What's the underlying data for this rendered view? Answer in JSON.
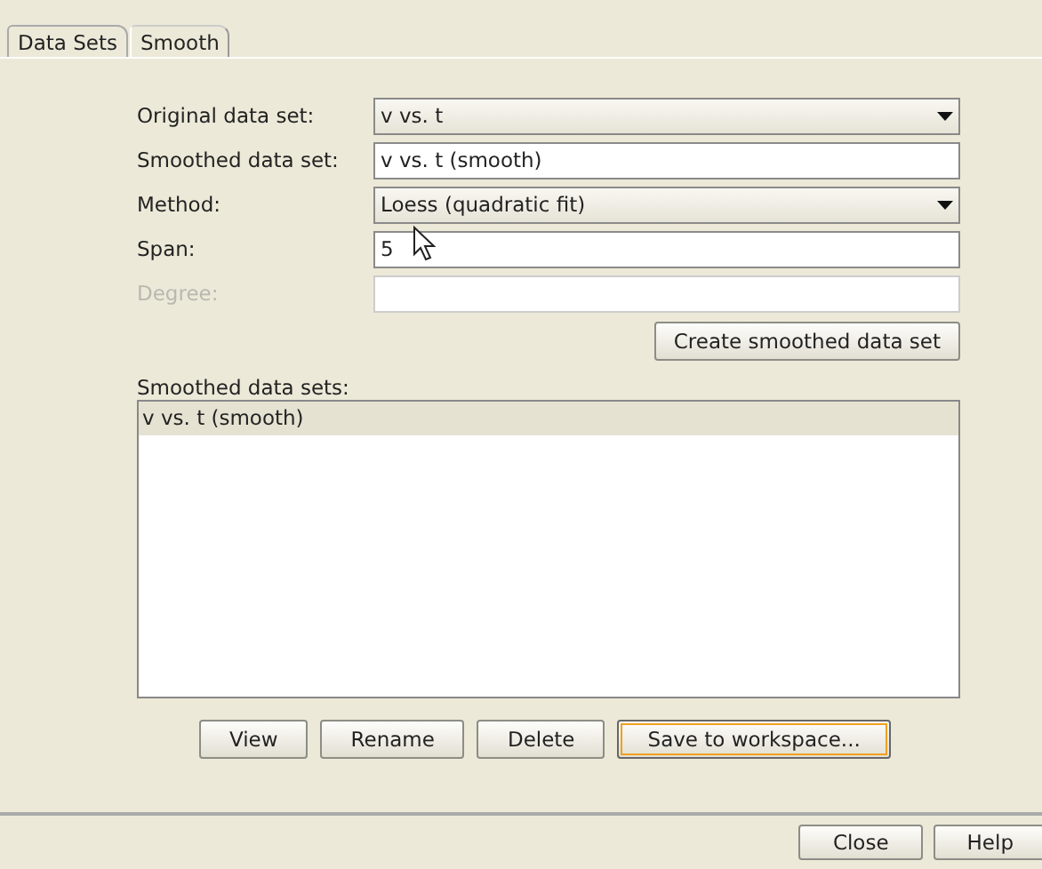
{
  "tabs": [
    {
      "label": "Data Sets",
      "selected": false
    },
    {
      "label": "Smooth",
      "selected": true
    }
  ],
  "form": [
    {
      "label": "Original data set:",
      "kind": "dropdown",
      "value": "v vs. t",
      "disabled": false
    },
    {
      "label": "Smoothed data set:",
      "kind": "text",
      "value": "v vs. t (smooth)",
      "disabled": false
    },
    {
      "label": "Method:",
      "kind": "dropdown",
      "value": "Loess (quadratic fit)",
      "disabled": false
    },
    {
      "label": "Span:",
      "kind": "text",
      "value": "5",
      "disabled": false
    },
    {
      "label": "Degree:",
      "kind": "text",
      "disabled": true
    }
  ],
  "create_button": "Create smoothed data set",
  "list": {
    "label": "Smoothed data sets:",
    "items": [
      {
        "label": "v vs. t (smooth)",
        "selected": true
      }
    ]
  },
  "list_buttons": [
    {
      "label": "View",
      "focused": false
    },
    {
      "label": "Rename",
      "focused": false
    },
    {
      "label": "Delete",
      "focused": false
    },
    {
      "label": "Save to workspace...",
      "focused": true
    }
  ],
  "footer_buttons": [
    {
      "label": "Close"
    },
    {
      "label": "Help"
    }
  ]
}
